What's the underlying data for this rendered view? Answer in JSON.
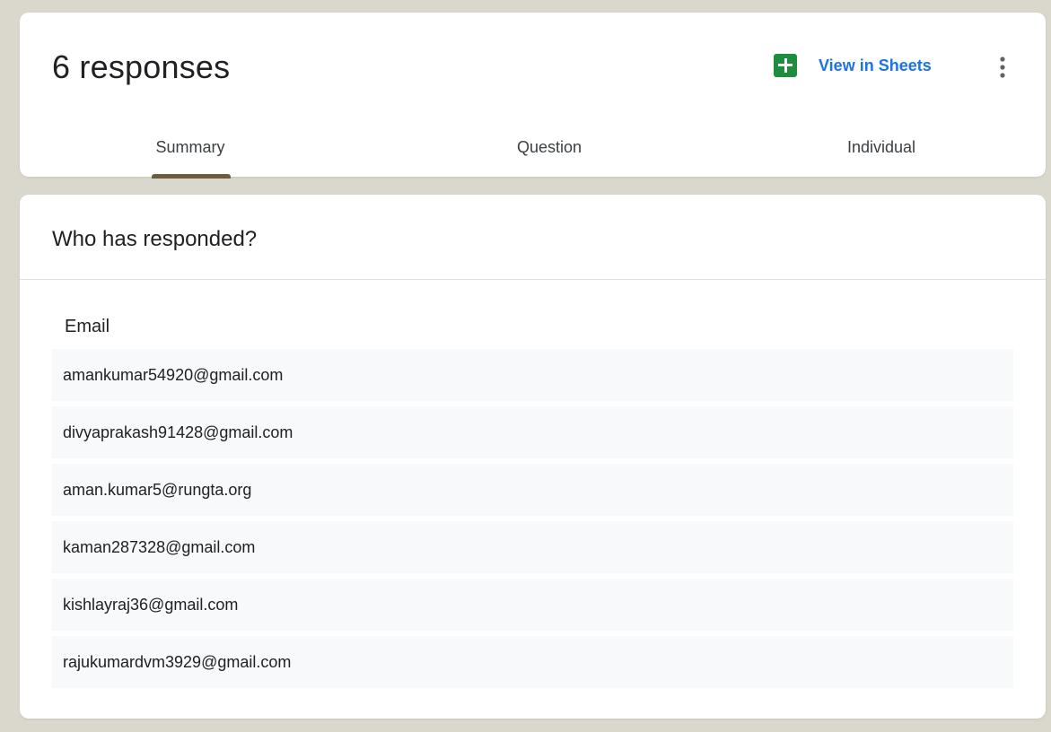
{
  "header": {
    "title": "6 responses",
    "sheets_label": "View in Sheets",
    "sheets_icon": "google-sheets-icon",
    "more_icon": "more-vert-icon",
    "accent_color": "#1a73e8",
    "sheets_color": "#1e8e3e"
  },
  "tabs": [
    {
      "label": "Summary",
      "selected": true
    },
    {
      "label": "Question",
      "selected": false
    },
    {
      "label": "Individual",
      "selected": false
    }
  ],
  "respondents": {
    "title": "Who has responded?",
    "column_header": "Email",
    "emails": [
      "amankumar54920@gmail.com",
      "divyaprakash91428@gmail.com",
      "aman.kumar5@rungta.org",
      "kaman287328@gmail.com",
      "kishlayraj36@gmail.com",
      "rajukumardvm3929@gmail.com"
    ]
  }
}
